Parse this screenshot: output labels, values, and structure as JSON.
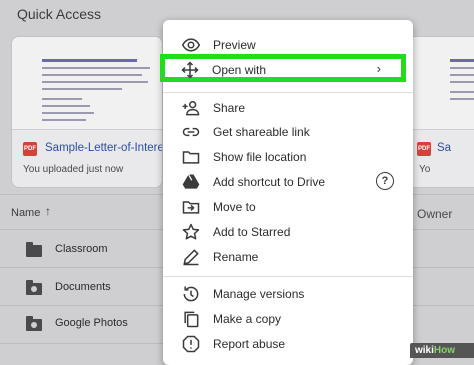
{
  "quick_access": {
    "title": "Quick Access",
    "cards": [
      {
        "file_name": "Sample-Letter-of-Interest...",
        "subtitle": "You uploaded just now",
        "badge": "PDF",
        "preview_title": "Sample Letter of Interest / Prospecting Letter"
      },
      {
        "file_name": "Sa",
        "subtitle": "Yo",
        "badge": "PDF"
      }
    ]
  },
  "list": {
    "column_name": "Name",
    "column_owner": "Owner",
    "sort_direction_icon": "arrow-up-icon",
    "rows": [
      {
        "label": "Classroom",
        "icon": "folder-icon"
      },
      {
        "label": "Documents",
        "icon": "shared-folder-icon"
      },
      {
        "label": "Google Photos",
        "icon": "shared-folder-icon"
      }
    ]
  },
  "context_menu": {
    "items": [
      {
        "label": "Preview",
        "icon": "eye-icon"
      },
      {
        "label": "Open with",
        "icon": "move-arrows-icon",
        "chevron": "›",
        "highlighted": true
      },
      {
        "label": "Share",
        "icon": "add-person-icon"
      },
      {
        "label": "Get shareable link",
        "icon": "link-icon"
      },
      {
        "label": "Show file location",
        "icon": "folder-outline-icon"
      },
      {
        "label": "Add shortcut to Drive",
        "icon": "drive-shortcut-icon",
        "help": "?"
      },
      {
        "label": "Move to",
        "icon": "move-to-folder-icon"
      },
      {
        "label": "Add to Starred",
        "icon": "star-outline-icon"
      },
      {
        "label": "Rename",
        "icon": "pencil-icon"
      },
      {
        "label": "Manage versions",
        "icon": "history-icon"
      },
      {
        "label": "Make a copy",
        "icon": "copy-icon"
      },
      {
        "label": "Report abuse",
        "icon": "report-icon"
      }
    ],
    "highlight_color": "#22dd1e"
  },
  "watermark": {
    "prefix": "wiki",
    "suffix": "How"
  }
}
